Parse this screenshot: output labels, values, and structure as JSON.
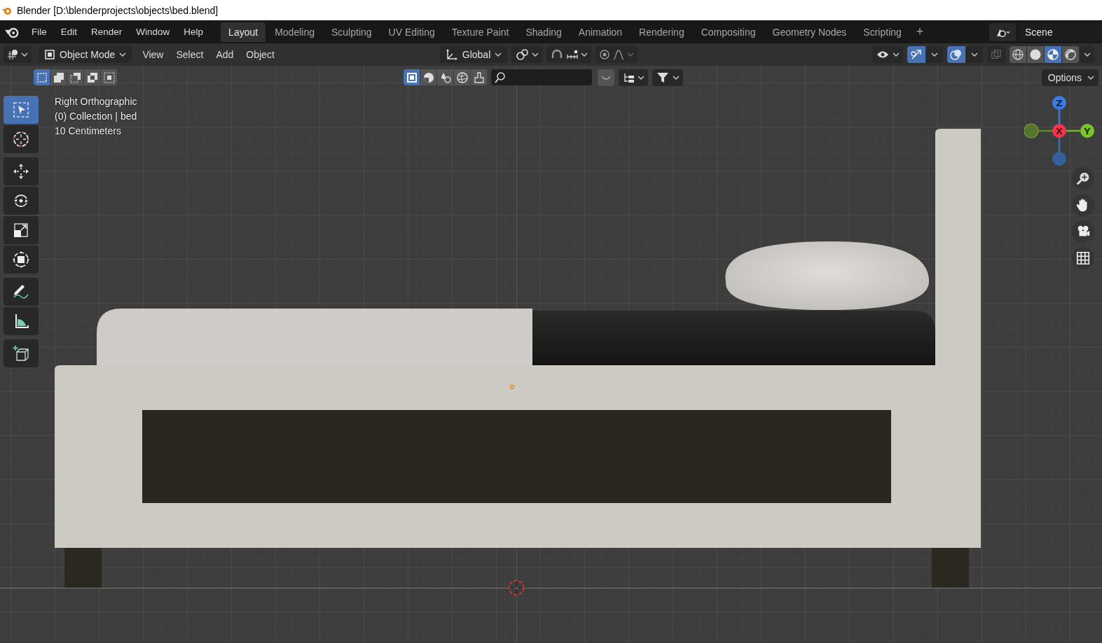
{
  "window": {
    "title": "Blender [D:\\blenderprojects\\objects\\bed.blend]"
  },
  "menu": [
    "File",
    "Edit",
    "Render",
    "Window",
    "Help"
  ],
  "workspaces": [
    {
      "label": "Layout",
      "selected": true
    },
    {
      "label": "Modeling",
      "selected": false
    },
    {
      "label": "Sculpting",
      "selected": false
    },
    {
      "label": "UV Editing",
      "selected": false
    },
    {
      "label": "Texture Paint",
      "selected": false
    },
    {
      "label": "Shading",
      "selected": false
    },
    {
      "label": "Animation",
      "selected": false
    },
    {
      "label": "Rendering",
      "selected": false
    },
    {
      "label": "Compositing",
      "selected": false
    },
    {
      "label": "Geometry Nodes",
      "selected": false
    },
    {
      "label": "Scripting",
      "selected": false
    }
  ],
  "add_workspace": "+",
  "scene": {
    "value": "Scene"
  },
  "header": {
    "mode": "Object Mode",
    "menus": [
      "View",
      "Select",
      "Add",
      "Object"
    ],
    "orientation": "Global",
    "snap_on": false,
    "proportional_on": false,
    "gizmos_on": true,
    "overlays_on": true,
    "xray_on": false,
    "shading": [
      {
        "kind": "wireframe",
        "selected": false
      },
      {
        "kind": "solid",
        "selected": false
      },
      {
        "kind": "material",
        "selected": true
      },
      {
        "kind": "rendered",
        "selected": false
      }
    ]
  },
  "select_modes": [
    {
      "kind": "set",
      "selected": true
    },
    {
      "kind": "extend",
      "selected": false
    },
    {
      "kind": "subtract",
      "selected": false
    },
    {
      "kind": "invert",
      "selected": false
    },
    {
      "kind": "intersect",
      "selected": false
    }
  ],
  "filters": [
    {
      "kind": "selectable",
      "selected": true
    },
    {
      "kind": "solid",
      "selected": false
    },
    {
      "kind": "material",
      "selected": false
    },
    {
      "kind": "rendered",
      "selected": false
    },
    {
      "kind": "brush",
      "selected": false
    }
  ],
  "options": "Options",
  "viewport": {
    "view_name": "Right Orthographic",
    "collection": "(0) Collection | bed",
    "scale": "10 Centimeters"
  },
  "gizmo": {
    "x": "X",
    "y": "Y",
    "z": "Z"
  },
  "tools": [
    {
      "kind": "select",
      "selected": true
    },
    {
      "kind": "cursor",
      "selected": false
    },
    {
      "kind": "move",
      "selected": false
    },
    {
      "kind": "rotate",
      "selected": false
    },
    {
      "kind": "scale",
      "selected": false
    },
    {
      "kind": "transform",
      "selected": false
    },
    {
      "kind": "annotate",
      "selected": false
    },
    {
      "kind": "measure",
      "selected": false
    },
    {
      "kind": "add_cube",
      "selected": false
    }
  ]
}
